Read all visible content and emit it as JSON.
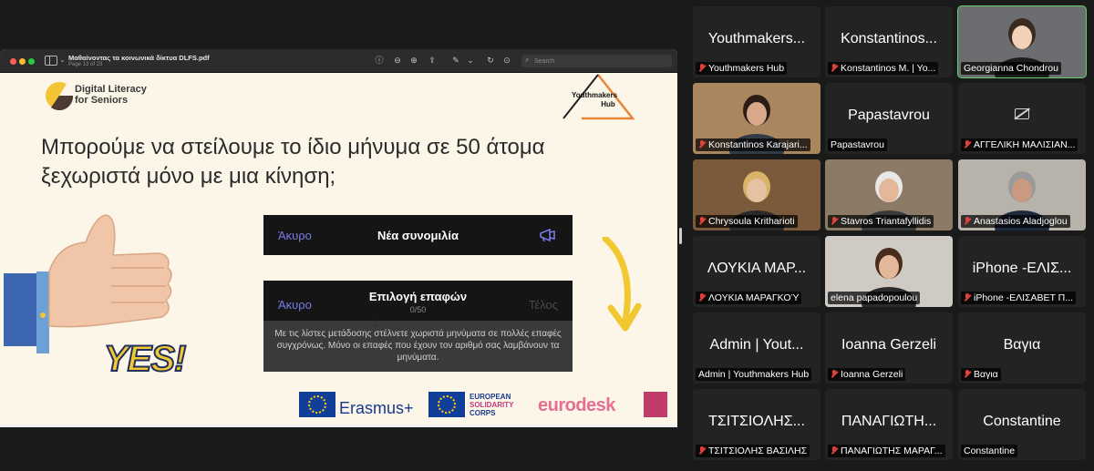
{
  "pdf_viewer": {
    "doc_title": "Μαθαίνοντας τα κοινωνικά δίκτυα DLFS.pdf",
    "page_indicator": "Page 13 of 23",
    "search_placeholder": "Search"
  },
  "slide": {
    "dls_logo_line1": "Digital Literacy",
    "dls_logo_line2": "for Seniors",
    "yh_logo_line1": "Youthmakers",
    "yh_logo_line2": "Hub",
    "headline": "Μπορούμε να στείλουμε το ίδιο μήνυμα σε 50 άτομα ξεχωριστά μόνο με μια κίνηση;",
    "yes_text": "YES!",
    "phone_bar1": {
      "cancel": "Άκυρο",
      "title": "Νέα συνομιλία"
    },
    "phone_bar2": {
      "cancel": "Άκυρο",
      "title": "Επιλογή επαφών",
      "count": "0/50",
      "done": "Τέλος"
    },
    "phone_info": "Με τις λίστες μετάδοσης στέλνετε χωριστά μηνύματα σε πολλές επαφές συγχρόνως. Μόνο οι επαφές που έχουν τον αριθμό σας λαμβάνουν τα μηνύματα.",
    "sponsor_erasmus": "Erasmus+",
    "sponsor_esc": [
      "EUROPEAN",
      "SOLIDARITY",
      "CORPS"
    ],
    "sponsor_eurodesk": "eurodesk"
  },
  "participants": [
    {
      "big_name": "Youthmakers...",
      "label": "Youthmakers Hub",
      "muted": true,
      "video": "none"
    },
    {
      "big_name": "Konstantinos...",
      "label": "Konstantinos M. | Yo...",
      "muted": true,
      "video": "none"
    },
    {
      "big_name": "",
      "label": "Georgianna Chondrou",
      "muted": false,
      "video": "woman-presenter",
      "active": true
    },
    {
      "big_name": "",
      "label": "Konstantinos Karajari...",
      "muted": true,
      "video": "man-bookshelf"
    },
    {
      "big_name": "Papastavrou",
      "label": "Papastavrou",
      "muted": false,
      "video": "none"
    },
    {
      "big_name": "",
      "label": "ΑΓΓΕΛΙΚΗ ΜΑΛΙΣΙΑΝ...",
      "muted": true,
      "video": "camera-off"
    },
    {
      "big_name": "",
      "label": "Chrysoula Kritharioti",
      "muted": true,
      "video": "woman-library"
    },
    {
      "big_name": "",
      "label": "Stavros Triantafyllidis",
      "muted": true,
      "video": "older-man"
    },
    {
      "big_name": "",
      "label": "Anastasios Aladjoglou",
      "muted": true,
      "video": "man-room"
    },
    {
      "big_name": "ΛΟΥΚΙΑ ΜΑΡ...",
      "label": "ΛΟΥΚΙΑ ΜΑΡΑΓΚΟΎ",
      "muted": true,
      "video": "none"
    },
    {
      "big_name": "",
      "label": "elena papadopoulou",
      "muted": false,
      "video": "woman-curly"
    },
    {
      "big_name": "iPhone -ΕΛΙΣ...",
      "label": "iPhone -ΕΛΙΣΑΒΕΤ Π...",
      "muted": true,
      "video": "none"
    },
    {
      "big_name": "Admin | Yout...",
      "label": "Admin | Youthmakers Hub",
      "muted": false,
      "video": "none"
    },
    {
      "big_name": "Ioanna Gerzeli",
      "label": "Ioanna Gerzeli",
      "muted": true,
      "video": "none"
    },
    {
      "big_name": "Βαγια",
      "label": "Βαγια",
      "muted": true,
      "video": "none"
    },
    {
      "big_name": "ΤΣΙΤΣΙΟΛΗΣ...",
      "label": "ΤΣΙΤΣΙΟΛΗΣ ΒΑΣΙΛΗΣ",
      "muted": true,
      "video": "none"
    },
    {
      "big_name": "ΠΑΝΑΓΙΩΤΗ...",
      "label": "ΠΑΝΑΓΙΩΤΗΣ ΜΑΡΑΓ...",
      "muted": true,
      "video": "none"
    },
    {
      "big_name": "Constantine",
      "label": "Constantine",
      "muted": false,
      "video": "none"
    }
  ],
  "colors": {
    "slide_bg": "#fcf6e9",
    "ios_link": "#7a7ae8",
    "muted_mic": "#e0413c",
    "active_speaker": "#5fd16a"
  }
}
